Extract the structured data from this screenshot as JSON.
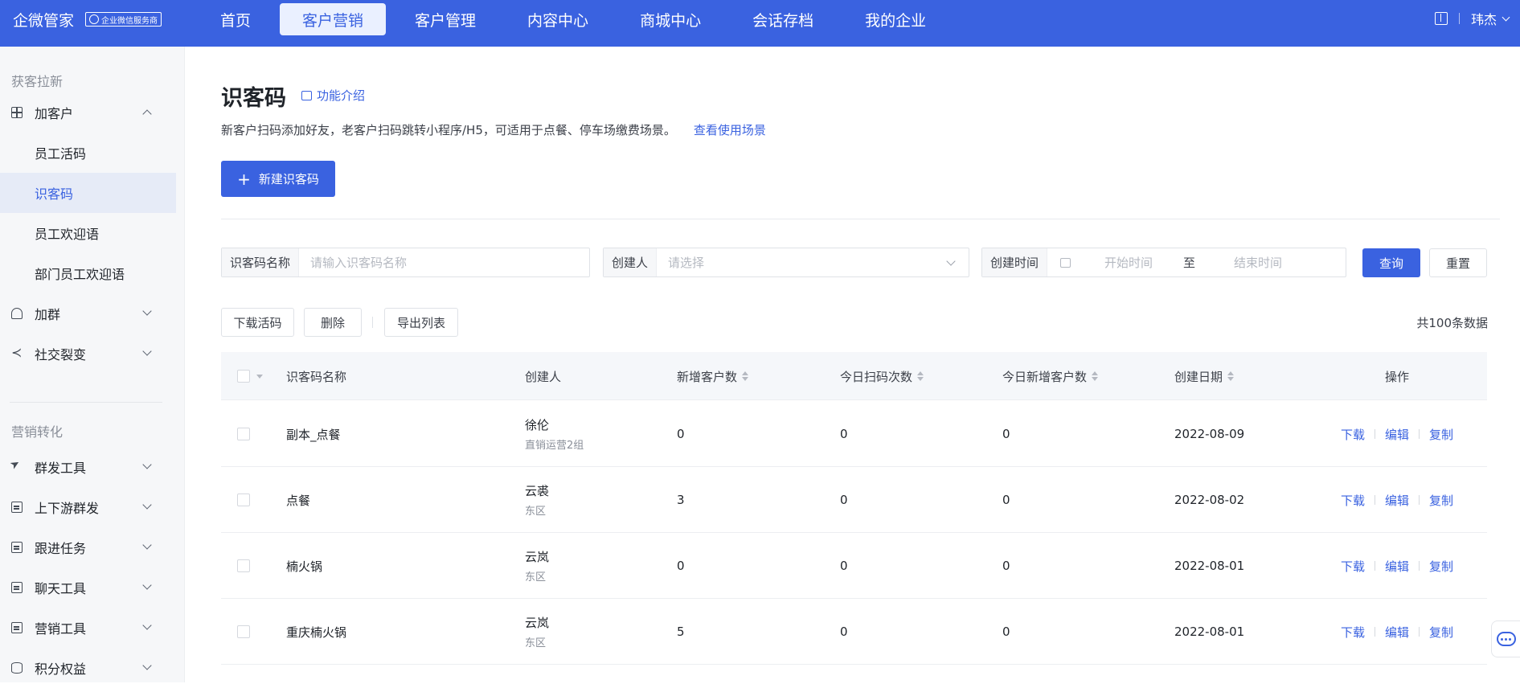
{
  "brand": {
    "name": "企微管家",
    "badge": "企业微信服务商"
  },
  "nav": [
    {
      "label": "首页"
    },
    {
      "label": "客户营销"
    },
    {
      "label": "客户管理"
    },
    {
      "label": "内容中心"
    },
    {
      "label": "商城中心"
    },
    {
      "label": "会话存档"
    },
    {
      "label": "我的企业"
    }
  ],
  "user": {
    "name": "玮杰"
  },
  "sidebar": {
    "group1": "获客拉新",
    "add_customer": "加客户",
    "sub_items": [
      "员工活码",
      "识客码",
      "员工欢迎语",
      "部门员工欢迎语"
    ],
    "add_group": "加群",
    "social": "社交裂变",
    "group2": "营销转化",
    "items2": [
      "群发工具",
      "上下游群发",
      "跟进任务",
      "聊天工具",
      "营销工具",
      "积分权益"
    ]
  },
  "page": {
    "title": "识客码",
    "intro_link": "功能介绍",
    "description": "新客户扫码添加好友，老客户扫码跳转小程序/H5，可适用于点餐、停车场缴费场景。",
    "scenario_link": "查看使用场景",
    "new_button": "新建识客码"
  },
  "filters": {
    "name_label": "识客码名称",
    "name_placeholder": "请输入识客码名称",
    "creator_label": "创建人",
    "creator_placeholder": "请选择",
    "time_label": "创建时间",
    "start_placeholder": "开始时间",
    "to": "至",
    "end_placeholder": "结束时间",
    "query": "查询",
    "reset": "重置"
  },
  "toolbar": {
    "download": "下载活码",
    "delete": "删除",
    "export": "导出列表",
    "total": "共100条数据"
  },
  "table": {
    "headers": [
      "识客码名称",
      "创建人",
      "新增客户数",
      "今日扫码次数",
      "今日新增客户数",
      "创建日期",
      "操作"
    ],
    "ops": [
      "下载",
      "编辑",
      "复制"
    ],
    "rows": [
      {
        "name": "副本_点餐",
        "creator": "徐伦",
        "dept": "直销运营2组",
        "new": "0",
        "scan": "0",
        "today_new": "0",
        "date": "2022-08-09"
      },
      {
        "name": "点餐",
        "creator": "云裘",
        "dept": "东区",
        "new": "3",
        "scan": "0",
        "today_new": "0",
        "date": "2022-08-02"
      },
      {
        "name": "楠火锅",
        "creator": "云岚",
        "dept": "东区",
        "new": "0",
        "scan": "0",
        "today_new": "0",
        "date": "2022-08-01"
      },
      {
        "name": "重庆楠火锅",
        "creator": "云岚",
        "dept": "东区",
        "new": "5",
        "scan": "0",
        "today_new": "0",
        "date": "2022-08-01"
      }
    ]
  }
}
